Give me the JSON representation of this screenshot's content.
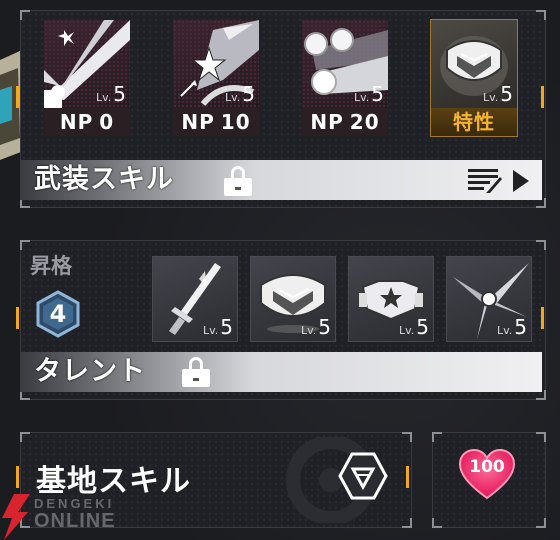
{
  "weapon_skills": {
    "title": "武装スキル",
    "cards": [
      {
        "icon": "burst-rays-icon",
        "level_prefix": "Lv.",
        "level": "5",
        "type_label": "NP",
        "cost": "0"
      },
      {
        "icon": "star-slash-icon",
        "level_prefix": "Lv.",
        "level": "5",
        "type_label": "NP",
        "cost": "10"
      },
      {
        "icon": "triple-orb-icon",
        "level_prefix": "Lv.",
        "level": "5",
        "type_label": "NP",
        "cost": "20"
      },
      {
        "icon": "shield-emblem-icon",
        "level_prefix": "Lv.",
        "level": "5",
        "type_label": "特性",
        "cost": ""
      }
    ]
  },
  "talent": {
    "title": "タレント",
    "rank_label": "昇格",
    "rank_value": "4",
    "cards": [
      {
        "icon": "sword-icon",
        "level_prefix": "Lv.",
        "level": "5"
      },
      {
        "icon": "shield-emblem-icon",
        "level_prefix": "Lv.",
        "level": "5"
      },
      {
        "icon": "fist-burst-icon",
        "level_prefix": "Lv.",
        "level": "5"
      },
      {
        "icon": "feather-burst-icon",
        "level_prefix": "Lv.",
        "level": "5"
      }
    ]
  },
  "base_skill": {
    "title": "基地スキル",
    "affection_value": "100"
  },
  "watermark": {
    "line1": "DENGEKI",
    "line2": "ONLINE"
  },
  "colors": {
    "accent_orange": "#f2a81d",
    "trait_gold": "#f4b432",
    "heart_pink": "#ff3d78"
  }
}
